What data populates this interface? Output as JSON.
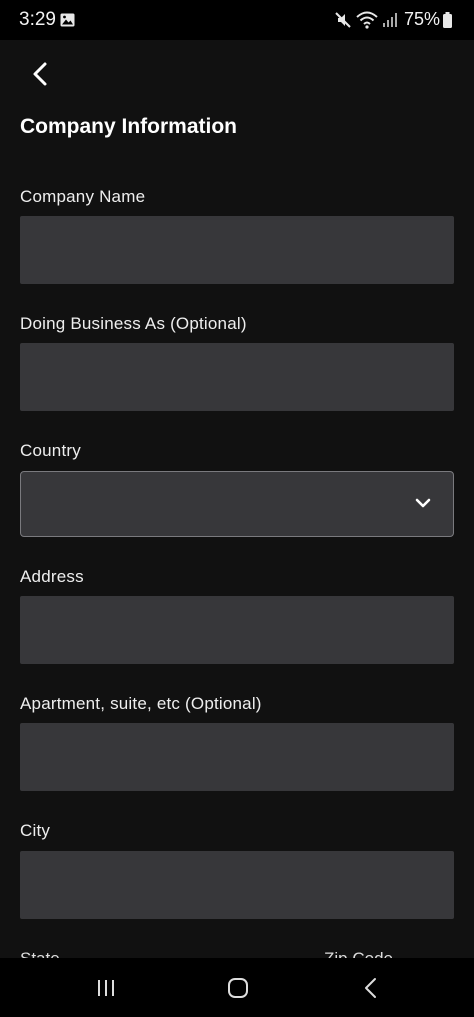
{
  "status_bar": {
    "time": "3:29",
    "battery": "75%",
    "icons": [
      "image-icon",
      "mute-icon",
      "wifi-icon",
      "signal-icon",
      "battery-icon"
    ]
  },
  "header": {
    "back_icon": "chevron-left-icon",
    "title": "Company Information"
  },
  "form": {
    "company_name": {
      "label": "Company Name",
      "value": ""
    },
    "dba": {
      "label": "Doing Business As (Optional)",
      "value": ""
    },
    "country": {
      "label": "Country",
      "value": "",
      "icon": "chevron-down-icon"
    },
    "address": {
      "label": "Address",
      "value": ""
    },
    "apartment": {
      "label": "Apartment, suite, etc (Optional)",
      "value": ""
    },
    "city": {
      "label": "City",
      "value": ""
    },
    "state": {
      "label": "State"
    },
    "zip": {
      "label": "Zip Code"
    }
  },
  "nav_bar": {
    "icons": [
      "recent-apps-icon",
      "home-icon",
      "back-icon"
    ]
  },
  "colors": {
    "background": "#111111",
    "input_fill": "#37373a",
    "select_border": "#7a7a7e",
    "text": "#ffffff"
  }
}
